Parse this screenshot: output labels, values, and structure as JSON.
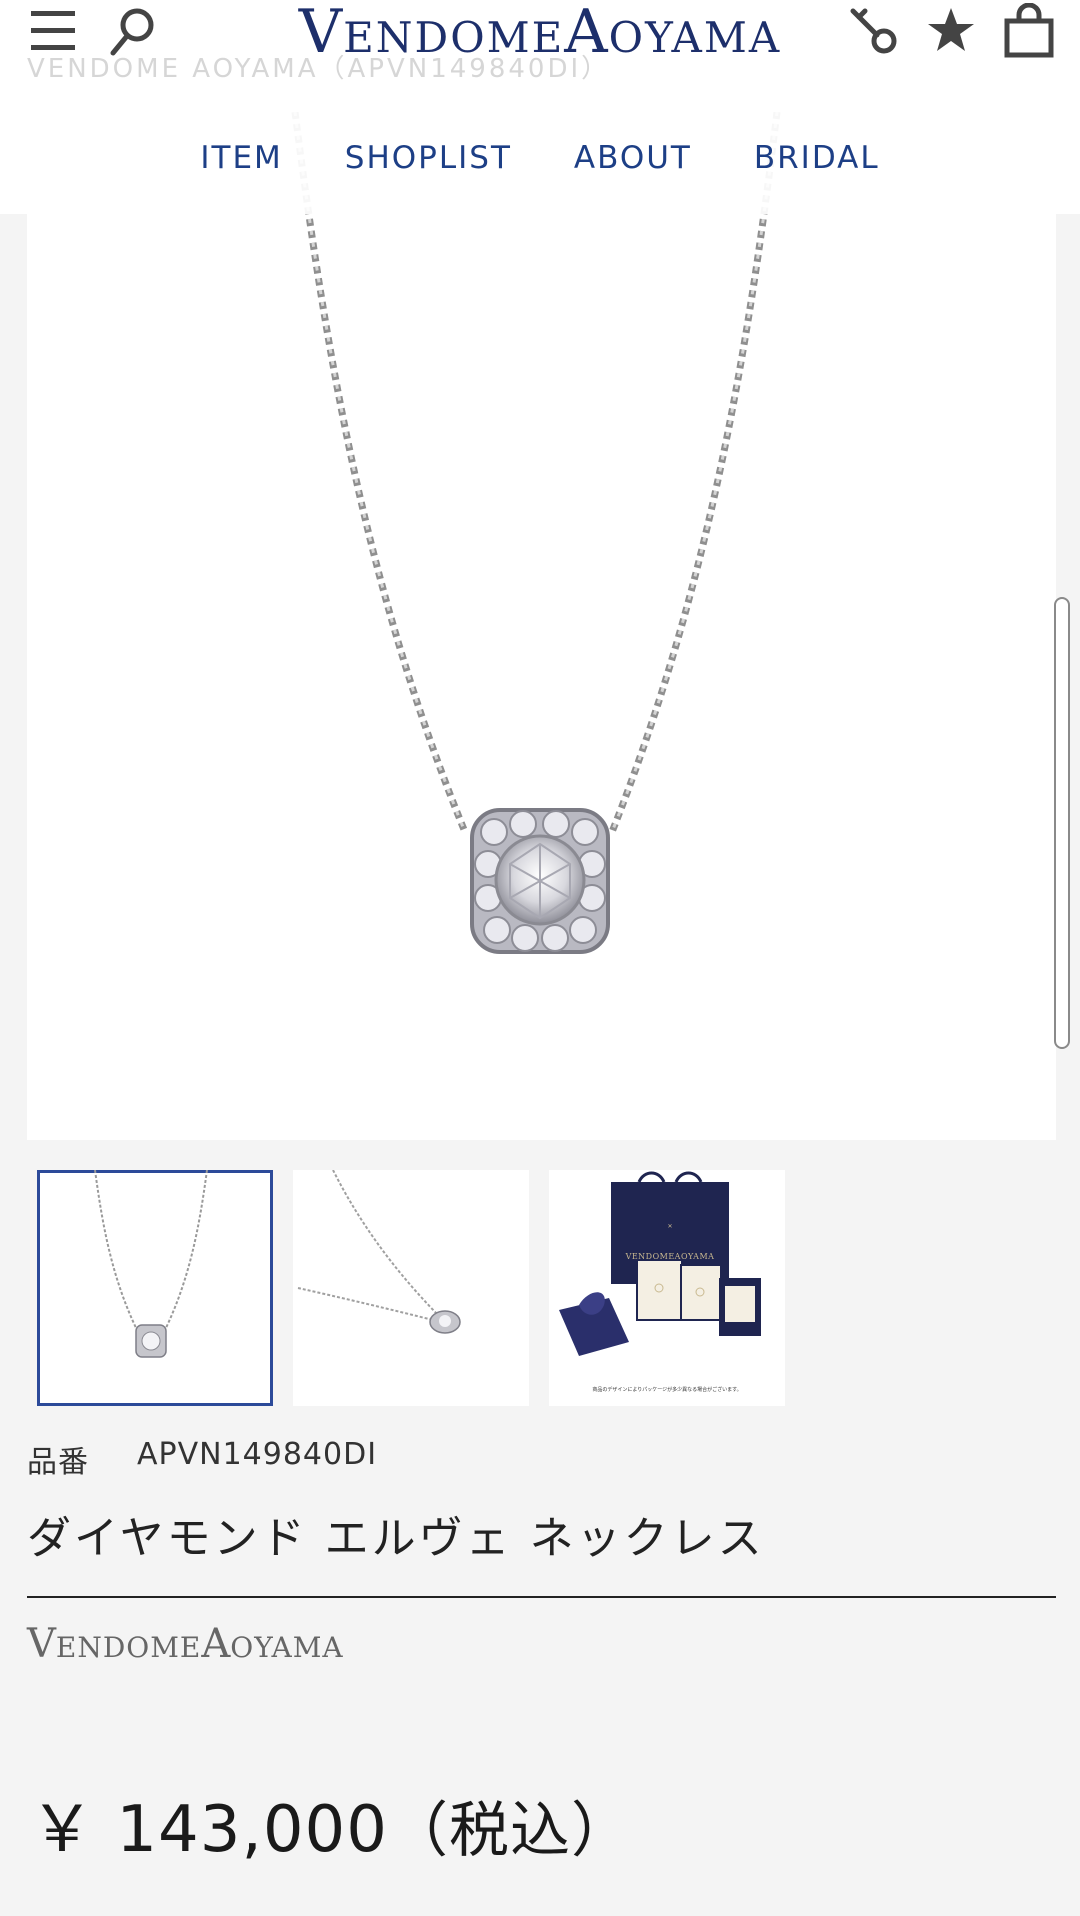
{
  "header": {
    "logo_v": "V",
    "logo_endome": "ENDOME",
    "logo_a": "A",
    "logo_oyama": "OYAMA",
    "breadcrumb_ghost": "VENDOME AOYAMA（APVN149840DI）",
    "icons": [
      "menu-icon",
      "search-icon",
      "key-icon",
      "star-icon",
      "bag-icon"
    ]
  },
  "nav": {
    "items": [
      {
        "label": "ITEM"
      },
      {
        "label": "SHOPLIST"
      },
      {
        "label": "ABOUT"
      },
      {
        "label": "BRIDAL"
      }
    ]
  },
  "gallery": {
    "thumbnails": [
      {
        "name": "necklace-front",
        "selected": true
      },
      {
        "name": "necklace-side",
        "selected": false
      },
      {
        "name": "gift-packaging",
        "selected": false,
        "logo_text": "VENDOMEAOYAMA",
        "caption": "商品のデザインによりパッケージが多少異なる場合がございます。"
      }
    ]
  },
  "product": {
    "sku_label": "品番",
    "sku_value": "APVN149840DI",
    "name": "ダイヤモンド エルヴェ ネックレス",
    "brand_v": "V",
    "brand_endome": "ENDOME",
    "brand_a": "A",
    "brand_oyama": "OYAMA",
    "price": "￥ 143,000",
    "price_tax": "（税込）"
  },
  "colors": {
    "brand_navy": "#1d2f6b",
    "nav_blue": "#1d3f86",
    "thumb_selected": "#2c4a99",
    "background": "#f4f4f4"
  }
}
